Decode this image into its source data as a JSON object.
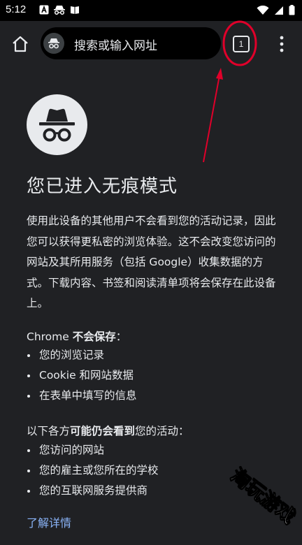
{
  "status_bar": {
    "time": "5:12",
    "left_icons": [
      "a-box-icon",
      "incognito-icon",
      "book-icon"
    ],
    "right_icons": [
      "wifi-icon",
      "signal-icon",
      "battery-icon"
    ]
  },
  "toolbar": {
    "omnibox_placeholder": "搜索或输入网址",
    "tab_count": "1"
  },
  "page": {
    "title": "您已进入无痕模式",
    "intro": "使用此设备的其他用户不会看到您的活动记录，因此您可以获得更私密的浏览体验。这不会改变您访问的网站及其所用服务（包括 Google）收集数据的方式。下载内容、书签和阅读清单项将会保存在此设备上。",
    "not_saved": {
      "heading_prefix": "Chrome ",
      "heading_bold": "不会保存",
      "heading_suffix": "：",
      "items": [
        "您的浏览记录",
        "Cookie 和网站数据",
        "在表单中填写的信息"
      ]
    },
    "may_see": {
      "heading_prefix": "以下各方",
      "heading_bold": "可能仍会看到",
      "heading_suffix": "您的活动：",
      "items": [
        "您访问的网站",
        "您的雇主或您所在的学校",
        "您的互联网服务提供商"
      ]
    },
    "learn_more": "了解详情"
  },
  "watermark": "淘玩游戏",
  "colors": {
    "background": "#202124",
    "text": "#e8eaed",
    "link": "#8ab4f8",
    "annotation": "#e0002a"
  }
}
